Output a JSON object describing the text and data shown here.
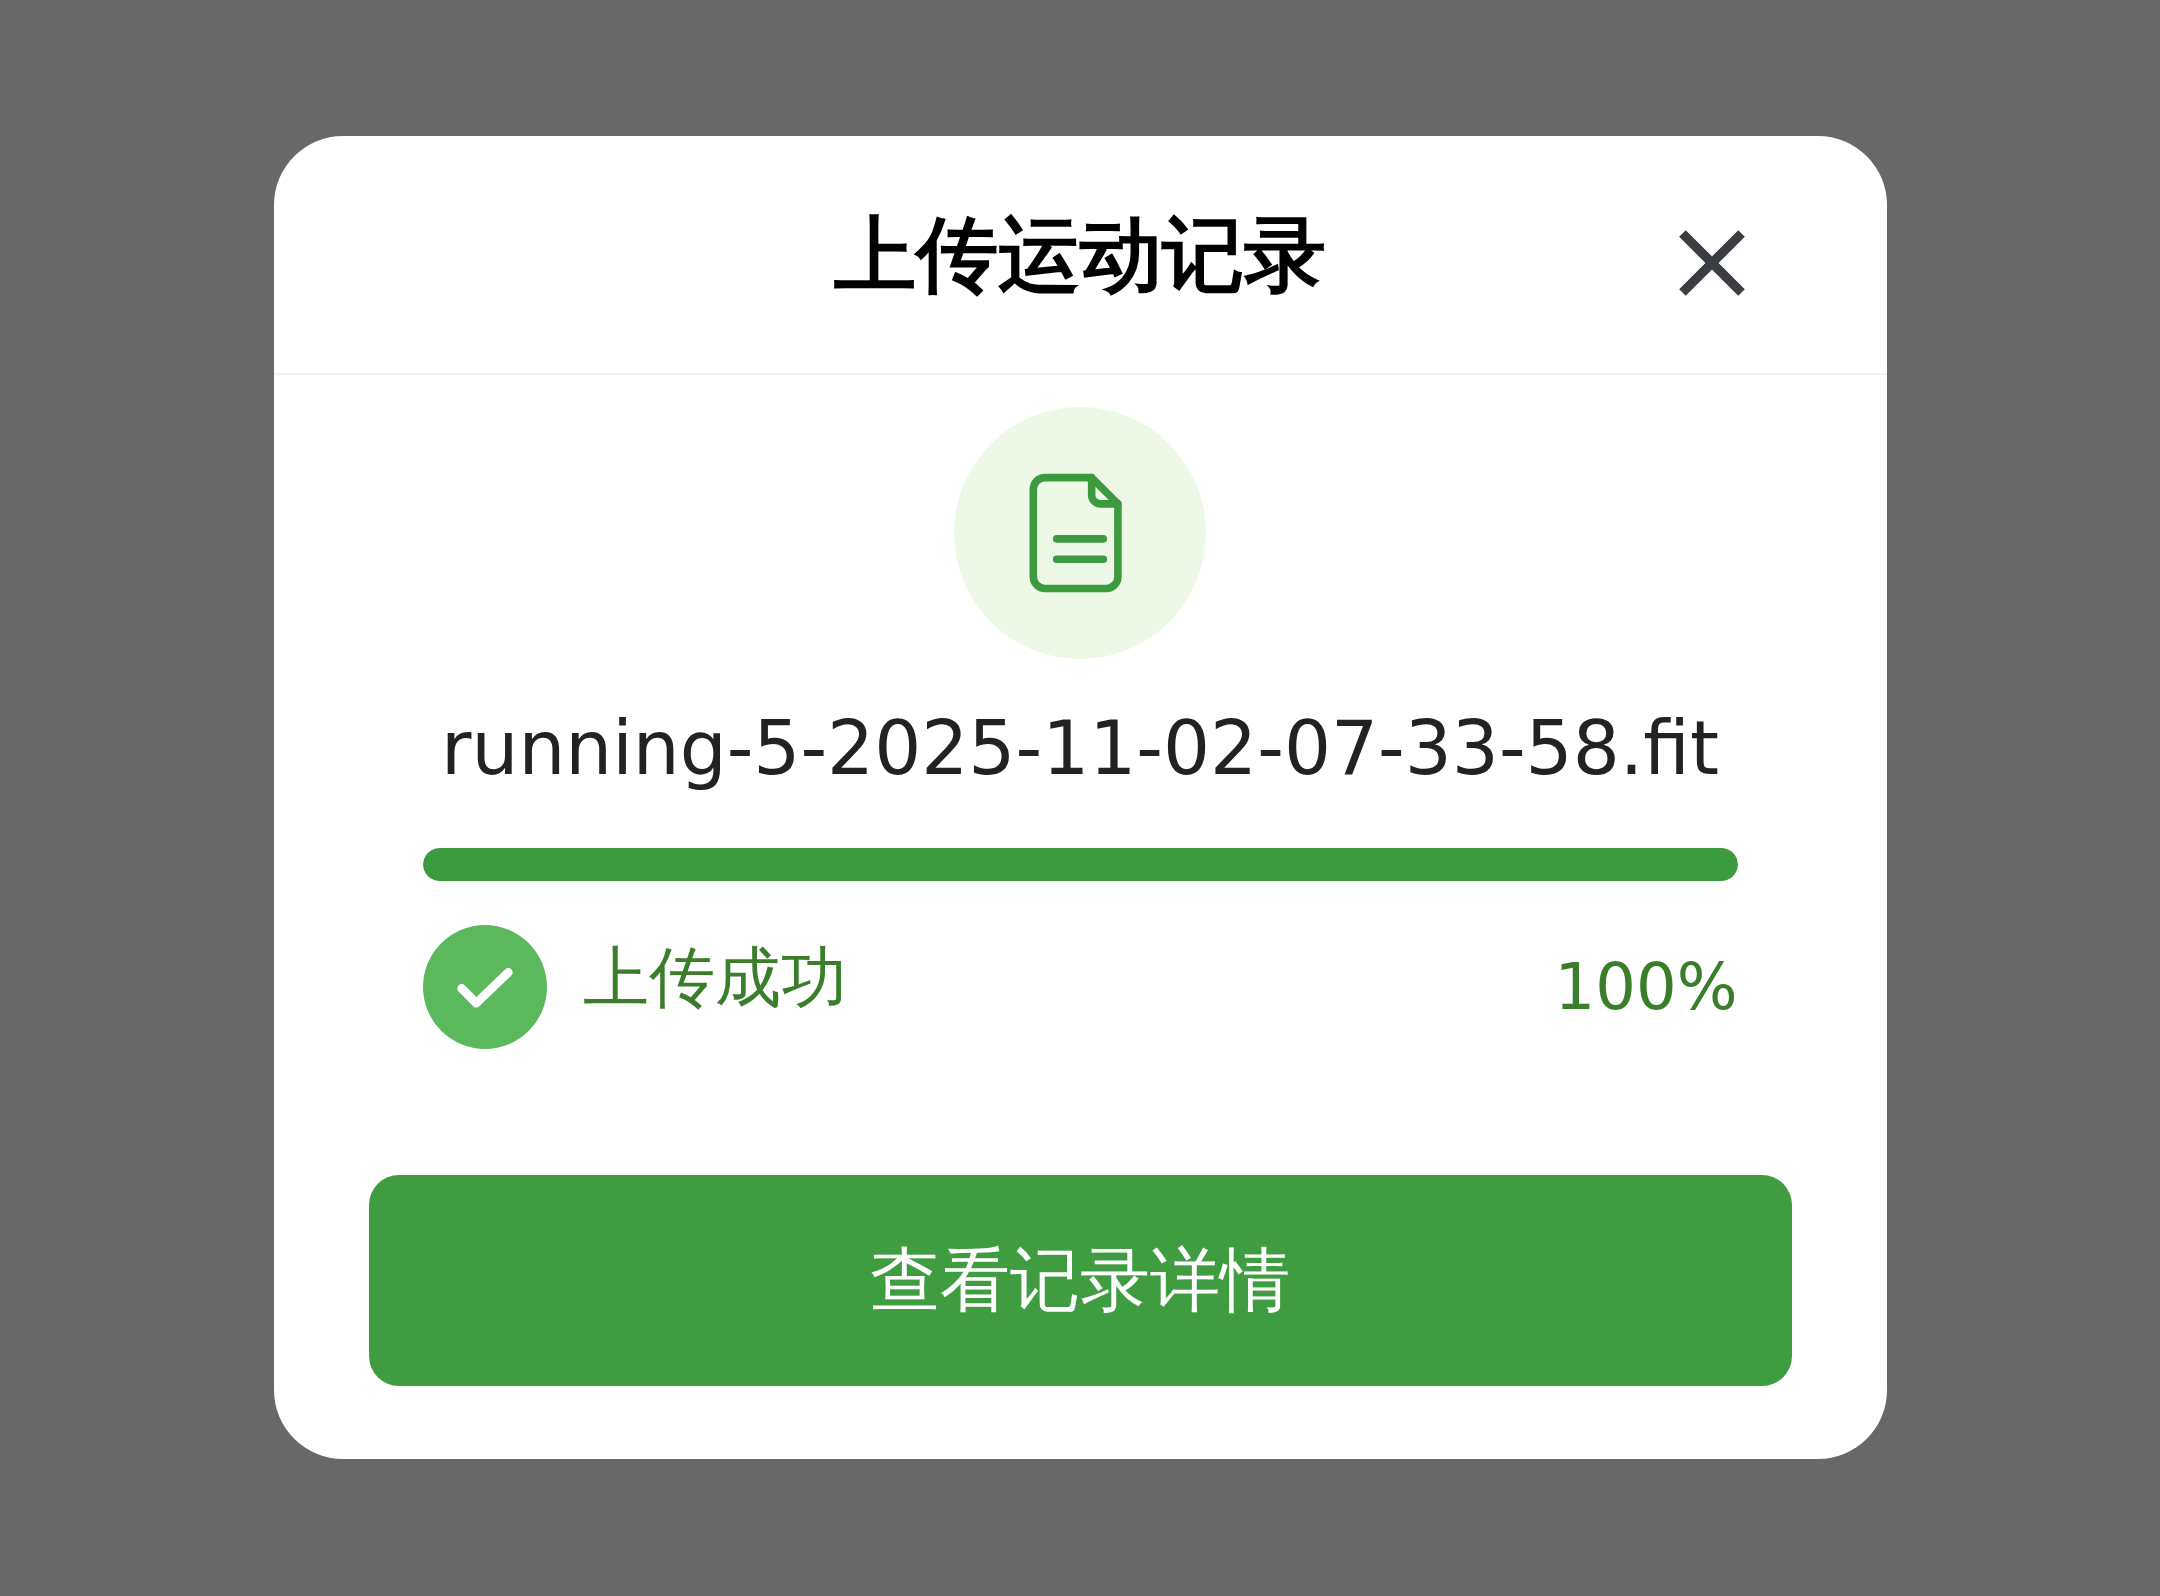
{
  "dialog": {
    "title": "上传运动记录"
  },
  "file": {
    "name": "running-5-2025-11-02-07-33-58.fit"
  },
  "progress": {
    "level": 1,
    "status": "上传成功",
    "success": true,
    "reading": "100%"
  },
  "button": {
    "label": "查看记录详情"
  }
}
